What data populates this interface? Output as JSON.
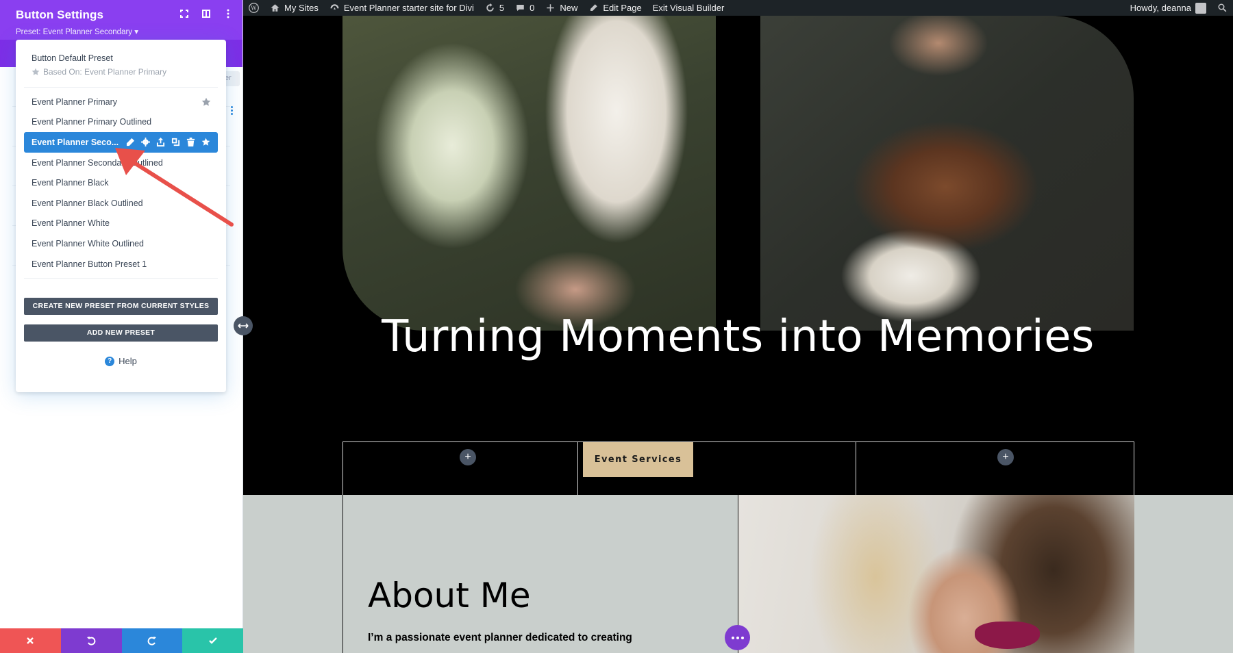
{
  "adminbar": {
    "my_sites": "My Sites",
    "site_name": "Event Planner starter site for Divi",
    "updates_count": "5",
    "comments_count": "0",
    "new_label": "New",
    "edit_page": "Edit Page",
    "exit_builder": "Exit Visual Builder",
    "howdy": "Howdy, deanna"
  },
  "panel": {
    "title": "Button Settings",
    "preset_line": "Preset: Event Planner Secondary ▾",
    "ghost_btn": "er"
  },
  "presets": {
    "default_name": "Button Default Preset",
    "default_based_on": "Based On: Event Planner Primary",
    "items": [
      {
        "label": "Event Planner Primary"
      },
      {
        "label": "Event Planner Primary Outlined"
      },
      {
        "label": "Event Planner Seco..."
      },
      {
        "label": "Event Planner Secondary Outlined"
      },
      {
        "label": "Event Planner Black"
      },
      {
        "label": "Event Planner Black Outlined"
      },
      {
        "label": "Event Planner White"
      },
      {
        "label": "Event Planner White Outlined"
      },
      {
        "label": "Event Planner Button Preset 1"
      }
    ],
    "create_btn": "CREATE NEW PRESET FROM CURRENT STYLES",
    "add_btn": "ADD NEW PRESET",
    "help": "Help"
  },
  "page": {
    "headline": "Turning Moments into Memories",
    "service_button": "Event Services",
    "about_title": "About Me",
    "about_text": "I’m a passionate event planner dedicated to creating",
    "plus": "+"
  },
  "colors": {
    "panel_purple": "#8a3ff0",
    "active_blue": "#2b87da",
    "service_tan": "#d9c198",
    "cancel_red": "#ef5555",
    "save_teal": "#29c4a9"
  }
}
